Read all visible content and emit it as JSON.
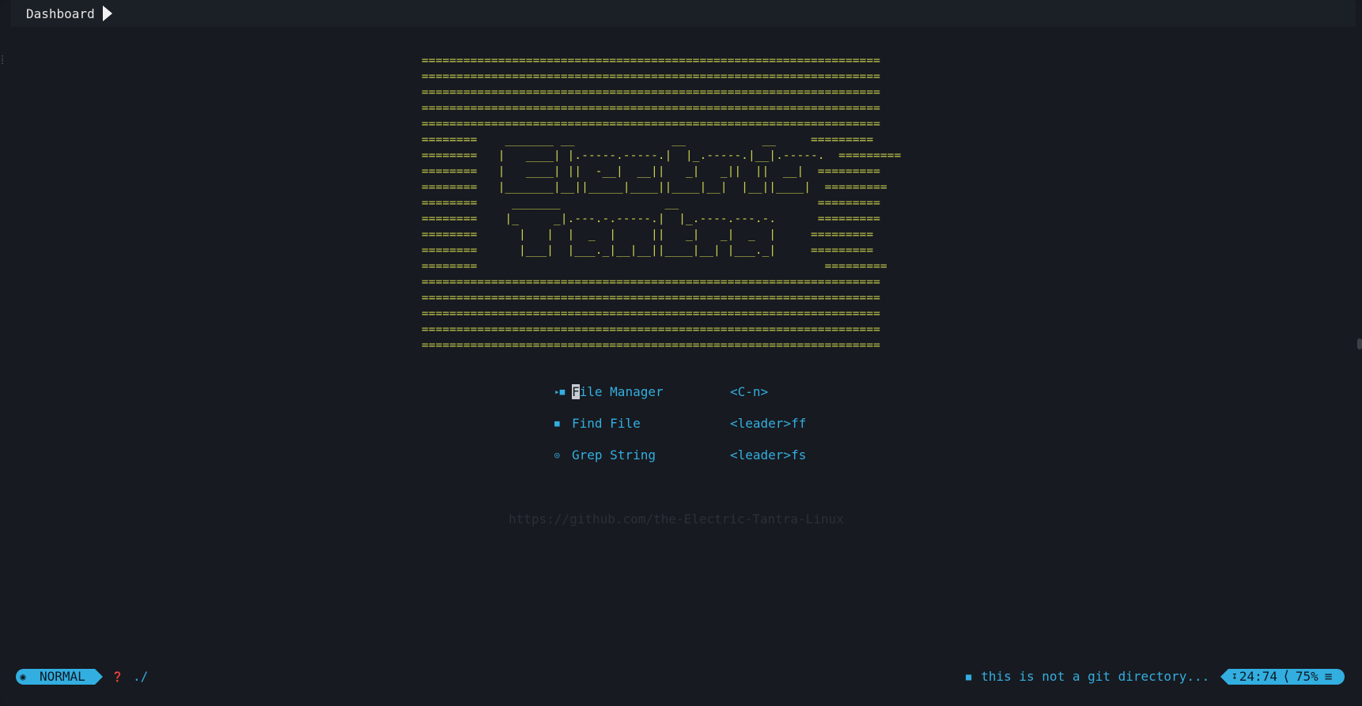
{
  "tabline": {
    "tab_label": "Dashboard"
  },
  "banner": {
    "lines": [
      "==================================================================",
      "==================================================================",
      "==================================================================",
      "==================================================================",
      "==================================================================",
      "========    _______ __              __           __     =========",
      "========   |   ____| |.-----.-----.|  |_.-----.|__|.-----.  =========",
      "========   |   ____| ||  -__|  __||   _|   _||  ||  __|  =========",
      "========   |_______|__||_____|____||____|__|  |__||____|  =========",
      "========     _______               __                    =========",
      "========    |_     _|.---.-.-----.|  |_.----.---.-.      =========",
      "========      |   |  |  _  |     ||   _|   _|  _  |     =========",
      "========      |___|  |___._|__|__||____|__| |___._|     =========",
      "========                                                  =========",
      "==================================================================",
      "==================================================================",
      "==================================================================",
      "==================================================================",
      "=================================================================="
    ],
    "color": "#c9cf4f"
  },
  "menu": {
    "items": [
      {
        "icon": "folder-open-icon",
        "glyph": "🗁",
        "label_first": "F",
        "label_rest": "ile Manager",
        "key": "<C-n>"
      },
      {
        "icon": "folder-icon",
        "glyph": "■",
        "label": "Find File",
        "key": "<leader>ff"
      },
      {
        "icon": "grep-icon",
        "glyph": "◌",
        "label": "Grep String",
        "key": "<leader>fs"
      }
    ],
    "accent": "#33aee0"
  },
  "footer": {
    "url": "https://github.com/the-Electric-Tantra-Linux"
  },
  "statusline": {
    "mode": "NORMAL",
    "cwd": "./",
    "git_message": "this is not a git directory...",
    "position": "24:74",
    "percent": "75%",
    "menu_glyph": "≡"
  }
}
